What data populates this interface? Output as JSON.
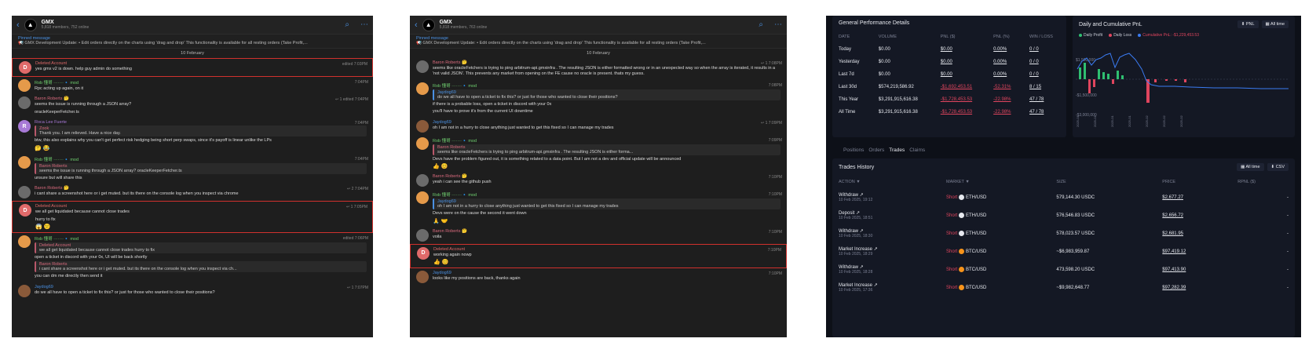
{
  "chat1": {
    "title": "GMX",
    "subtitle": "5,818 members, 752 online",
    "pinned_title": "Pinned message",
    "pinned_text": "📢 GMX Development Update:  • Edit orders directly on the charts using 'drag and drop'  This functionality is available for all resting orders (Take Profit,...",
    "date": "10 February",
    "messages": [
      {
        "name": "Deleted Account",
        "text": "yes gmx v2 is down. help guy admin do something",
        "time": "edited 7:03PM",
        "initial": "D",
        "color": "#e06a6a"
      },
      {
        "name": "Rob 懂哥 ·······🔹 mod",
        "text": "Rpc acting up again, on it",
        "time": "7:04PM"
      },
      {
        "name": "Baron Roberts 🤔",
        "text": "seems the issue is running through a JSON array?",
        "text2": "oracleKeeperFetcher.ts",
        "time": "↩ 1 edited 7:04PM"
      },
      {
        "name": "Roca Lee Fuerte",
        "quote_name": "Zook",
        "quote_text": "Thank you. I am relieved.  Have a nice day.",
        "text": "btw, this also explains why you can't get perfect risk hedging being short perp swaps, since it's payoff is linear unlike the LPs",
        "time": "7:04PM",
        "reacts": "🤔 😂",
        "initial": "R",
        "color": "#a779d6"
      },
      {
        "name": "Rob 懂哥 ·······🔹 mod",
        "quote_name": "Baron Roberts",
        "quote_text": "seems the issue is running through a JSON array?  oracleKeeperFetcher.ts",
        "text": "unsure but will share this",
        "time": "7:04PM"
      },
      {
        "name": "Baron Roberts 🤔",
        "text": "i cant share a screenshot here or i get muted. but its there on the console log when you inspect via chrome",
        "time": "↩ 2 7:04PM"
      },
      {
        "name": "Deleted Account",
        "text": "we all get liquidated because cannot close trades",
        "text2": "hurry to fix",
        "time": "↩ 1 7:05PM",
        "reacts": "😱 😕",
        "initial": "D",
        "color": "#e06a6a"
      },
      {
        "name": "Rob 懂哥 ·······🔹 mod",
        "quote_name": "Deleted Account",
        "quote_text": "we all get liquidated because cannot close trades hurry to fix",
        "text": "open a ticket in discord with your 0x, UI will be back shortly",
        "quote2_name": "Baron Roberts",
        "quote2_text": "i cant share a screenshot here or i get muted. but its there on the console log when you inspect via ch...",
        "text2": "you can dm me directly then send it",
        "time": "edited 7:06PM"
      },
      {
        "name": "Jaydog69",
        "text": "do we all have to open a ticket to fix this? or just for those who wanted to close their positions?",
        "time": "↩ 1 7:07PM"
      }
    ]
  },
  "chat2": {
    "title": "GMX",
    "subtitle": "5,818 members, 763 online",
    "pinned_title": "Pinned message",
    "pinned_text": "📢 GMX Development Update:  • Edit orders directly on the charts using 'drag and drop'  This functionality is available for all resting orders (Take Profit,...",
    "date": "10 February",
    "messages": [
      {
        "name": "Baron Roberts 🤔",
        "text": "seems like oracleFetchers is trying to ping arbitrum-api.gmxinfra . The resulting JSON is either formatted wrong or in an unexpected way so when the array is iterated, it results in a 'not valid JSON'. This prevents any market from opening on the FE cause no oracle is present. thats my guess.",
        "time": "↩ 1 7:08PM"
      },
      {
        "name": "Rob 懂哥 ·······🔹 mod",
        "quote_name": "Jaydog69",
        "quote_text": "do we all have to open a ticket to fix this? or just for those who wanted to close their positions?",
        "text": "if there is a probable loss, open a ticket in discord with your 0x",
        "text2": "you'll have to prove it's from the current UI downtime",
        "time": "7:08PM"
      },
      {
        "name": "Jaydog69",
        "text": "oh I am not in a hurry to close anything just wanted to get this fixed so I can manage my trades",
        "time": "↩ 1 7:09PM"
      },
      {
        "name": "Rob 懂哥 ·······🔹 mod",
        "quote_name": "Baron Roberts",
        "quote_text": "seems like oracleFetchers is trying to ping arbitrum-api.gmxinfra . The resulting JSON is either forma...",
        "text": "Devs have the problem figured out, it is something related to a data point. But I am not a dev and official update will be announced",
        "time": "7:09PM",
        "reacts": "👍 😊"
      },
      {
        "name": "Baron Roberts 🤔",
        "text": "yeah i can see the github push",
        "time": "7:10PM"
      },
      {
        "name": "Rob 懂哥 ·······🔹 mod",
        "quote_name": "Jaydog69",
        "quote_text": "oh I am not in a hurry to close anything just wanted to get this fixed so I can manage my trades",
        "text": "Devs were on the cause the second it went down",
        "time": "7:10PM",
        "reacts": "🙏 🤝"
      },
      {
        "name": "Baron Roberts 🤔",
        "text": "voila",
        "time": "7:10PM"
      },
      {
        "name": "Deleted Account",
        "text": "working again nowp",
        "time": "7:10PM",
        "reacts": "👍 😊",
        "initial": "D",
        "color": "#e06a6a"
      },
      {
        "name": "Jaydog69",
        "text": "looks like my positions are back, thanks again",
        "time": "7:10PM"
      }
    ]
  },
  "dash": {
    "perf_title": "General Performance Details",
    "perf_headers": [
      "DATE",
      "VOLUME",
      "PNL ($)",
      "PNL (%)",
      "WIN / LOSS"
    ],
    "perf_rows": [
      [
        "Today",
        "$0.00",
        "$0.00",
        "0.00%",
        "0 / 0"
      ],
      [
        "Yesterday",
        "$0.00",
        "$0.00",
        "0.00%",
        "0 / 0"
      ],
      [
        "Last 7d",
        "$0.00",
        "$0.00",
        "0.00%",
        "0 / 0"
      ],
      [
        "Last 30d",
        "$574,219,586.92",
        "-$1,692,453.51",
        "-52.31%",
        "8 / 15"
      ],
      [
        "This Year",
        "$3,291,915,616.38",
        "-$1,728,453.53",
        "-22.98%",
        "47 / 78"
      ],
      [
        "All Time",
        "$3,291,915,616.38",
        "-$1,728,453.53",
        "-22.98%",
        "47 / 78"
      ]
    ],
    "pnl_title": "Daily and Cumulative PnL",
    "pnl_btn": "PNL",
    "alltime_btn": "All time",
    "legend": [
      "Daily Profit",
      "Daily Loss",
      "Cumulative PnL: -$1,229,453.53"
    ],
    "y_ticks": [
      "$1,500,000",
      "-$1,500,000",
      "-$3,000,000"
    ],
    "tabs": [
      "Positions",
      "Orders",
      "Trades",
      "Claims"
    ],
    "history_title": "Trades History",
    "hist_btn1": "All time",
    "hist_btn2": "CSV",
    "hist_headers": [
      "ACTION ▼",
      "MARKET ▼",
      "SIZE",
      "PRICE",
      "RPNL ($)"
    ],
    "hist_rows": [
      {
        "action": "Withdraw ↗",
        "date": "10 Feb 2025, 19:12",
        "side": "Short",
        "market": "ETH/USD",
        "size": "579,144.30 USDC",
        "price": "$2,677.27",
        "rpnl": "-"
      },
      {
        "action": "Deposit ↗",
        "date": "10 Feb 2025, 18:51",
        "side": "Short",
        "market": "ETH/USD",
        "size": "576,546.83 USDC",
        "price": "$2,656.72",
        "rpnl": "-"
      },
      {
        "action": "Withdraw ↗",
        "date": "10 Feb 2025, 18:30",
        "side": "Short",
        "market": "ETH/USD",
        "size": "578,023.57 USDC",
        "price": "$2,681.95",
        "rpnl": "-"
      },
      {
        "action": "Market Increase ↗",
        "date": "10 Feb 2025, 18:29",
        "side": "Short",
        "market": "BTC/USD",
        "size": "~$6,983,959.87",
        "price": "$97,419.12",
        "rpnl": "-"
      },
      {
        "action": "Withdraw ↗",
        "date": "10 Feb 2025, 18:28",
        "side": "Short",
        "market": "BTC/USD",
        "size": "473,598.20 USDC",
        "price": "$97,413.90",
        "rpnl": "-"
      },
      {
        "action": "Market Increase ↗",
        "date": "10 Feb 2025, 17:36",
        "side": "Short",
        "market": "BTC/USD",
        "size": "~$9,982,648.77",
        "price": "$97,282.39",
        "rpnl": "-"
      }
    ]
  }
}
